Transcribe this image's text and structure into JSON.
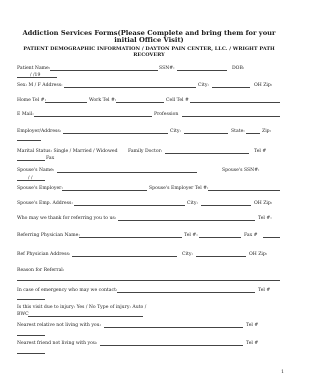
{
  "title": "Addiction Services Forms(Please Complete and bring them for your initial Office Visit)",
  "subtitle": "PATIENT DEMOGRAPHIC INFORMATION / DAYTON PAIN CENTER, LLC. / WRIGHT PATH RECOVERY",
  "fields": {
    "patient_name": "Patient Name:",
    "ssn": "SSN#:",
    "dob": "DOB:",
    "dob_fmt": "/ /19",
    "sex": "Sex: M / F Address:",
    "city": "City:",
    "oh_zip": "OH Zip:",
    "home_tel": "Home Tel #:",
    "work_tel": "Work Tel #:",
    "cell_tel": "Cell Tel #",
    "email": "E Mail:",
    "profession": "Profession",
    "employer_address": "Employer/Address:",
    "city2": "City:",
    "state": "State:",
    "zip": "Zip:",
    "marital": "Marital Status: Single / Married / Widowed",
    "family_doctor": "Family Doctor:",
    "tel": "Tel #",
    "fax": "Fax",
    "spouse_name": "Spouse's Name:",
    "spouse_ssn": "Spouse's SSN#:",
    "dob_short": "/ /",
    "spouse_employer": "Spouse's Employer:",
    "spouse_emp_tel": "Spouse's Employer Tel #:",
    "spouse_emp_address": "Spouse's Emp. Address:",
    "city3": "City:",
    "oh_zip2": "OH Zip:",
    "who_thank": "Who may we thank for referring you to us:",
    "tel2": "Tel #:",
    "referring_physician": "Referring Physician Name:",
    "tel3": "Tel #:",
    "fax2": "Fax #",
    "ref_physician_address": "Ref Physician Address:",
    "city4": "City:",
    "oh_zip3": "OH Zip:",
    "reason": "Reason for Referral:",
    "emergency": "In case of emergency who may we contact:",
    "tel4": "Tel #",
    "injury": "Is this visit due to injury: Yes / No Type of injury: Auto /",
    "bwc": "BWC",
    "nearest_relative": "Nearest relative not living with you:",
    "tel5": "Tel #",
    "nearest_friend": "Nearest friend not living with you:",
    "tel6": "Tel #"
  },
  "page_number": "1"
}
